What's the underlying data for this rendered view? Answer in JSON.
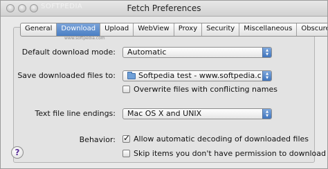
{
  "window": {
    "title": "Fetch Preferences",
    "watermark": "SOFTPEDIA"
  },
  "tabs": [
    {
      "label": "General",
      "selected": false
    },
    {
      "label": "Download",
      "selected": true
    },
    {
      "label": "Upload",
      "selected": false
    },
    {
      "label": "WebView",
      "selected": false
    },
    {
      "label": "Proxy",
      "selected": false
    },
    {
      "label": "Security",
      "selected": false
    },
    {
      "label": "Miscellaneous",
      "selected": false
    },
    {
      "label": "Obscure",
      "selected": false
    }
  ],
  "tab_watermark": "www.softpedia.com",
  "form": {
    "download_mode": {
      "label": "Default download mode:",
      "value": "Automatic"
    },
    "save_location": {
      "label": "Save downloaded files to:",
      "value": "Softpedia test - www.softpedia.c..."
    },
    "overwrite": {
      "label": "Overwrite files with conflicting names",
      "checked": false
    },
    "line_endings": {
      "label": "Text file line endings:",
      "value": "Mac OS X and UNIX"
    },
    "behavior": {
      "label": "Behavior:",
      "auto_decode": {
        "label": "Allow automatic decoding of downloaded files",
        "checked": true
      },
      "skip_items": {
        "label": "Skip items you don't have permission to download",
        "checked": false
      }
    }
  },
  "help": {
    "label": "?"
  },
  "colors": {
    "accent": "#4a7fc4",
    "window_bg": "#e9e9e9"
  }
}
